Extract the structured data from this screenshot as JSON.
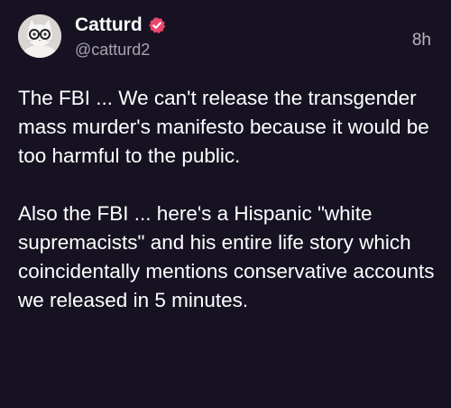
{
  "post": {
    "author": {
      "display_name": "Catturd",
      "handle": "@catturd2",
      "verified": true,
      "avatar_icon": "cat-avatar"
    },
    "timestamp": "8h",
    "paragraphs": [
      "The FBI ... We can't release the transgender mass murder's manifesto because it would be too harmful to the public.",
      "Also the FBI ... here's a Hispanic \"white supremacists\" and his entire life story which coincidentally mentions conservative accounts we released in 5 minutes."
    ]
  },
  "colors": {
    "background": "#171222",
    "text": "#ffffff",
    "secondary_text": "#a7a4b0",
    "verified_badge": "#e8476b"
  }
}
